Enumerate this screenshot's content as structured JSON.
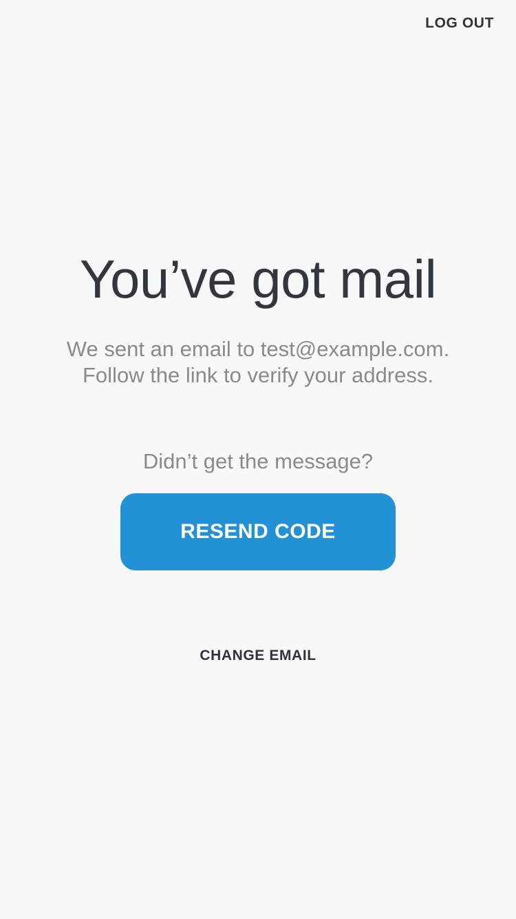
{
  "header": {
    "logout_label": "LOG OUT"
  },
  "main": {
    "title": "You’ve got mail",
    "message_line1": "We sent an email to test@example.com.",
    "message_line2": "Follow the link to verify your address.",
    "prompt": "Didn’t get the message?",
    "resend_label": "RESEND CODE",
    "change_email_label": "CHANGE EMAIL"
  },
  "colors": {
    "background": "#f8f8f8",
    "primary_button": "#2391d6",
    "title_text": "#33373b",
    "secondary_text": "#8a8a8a"
  }
}
